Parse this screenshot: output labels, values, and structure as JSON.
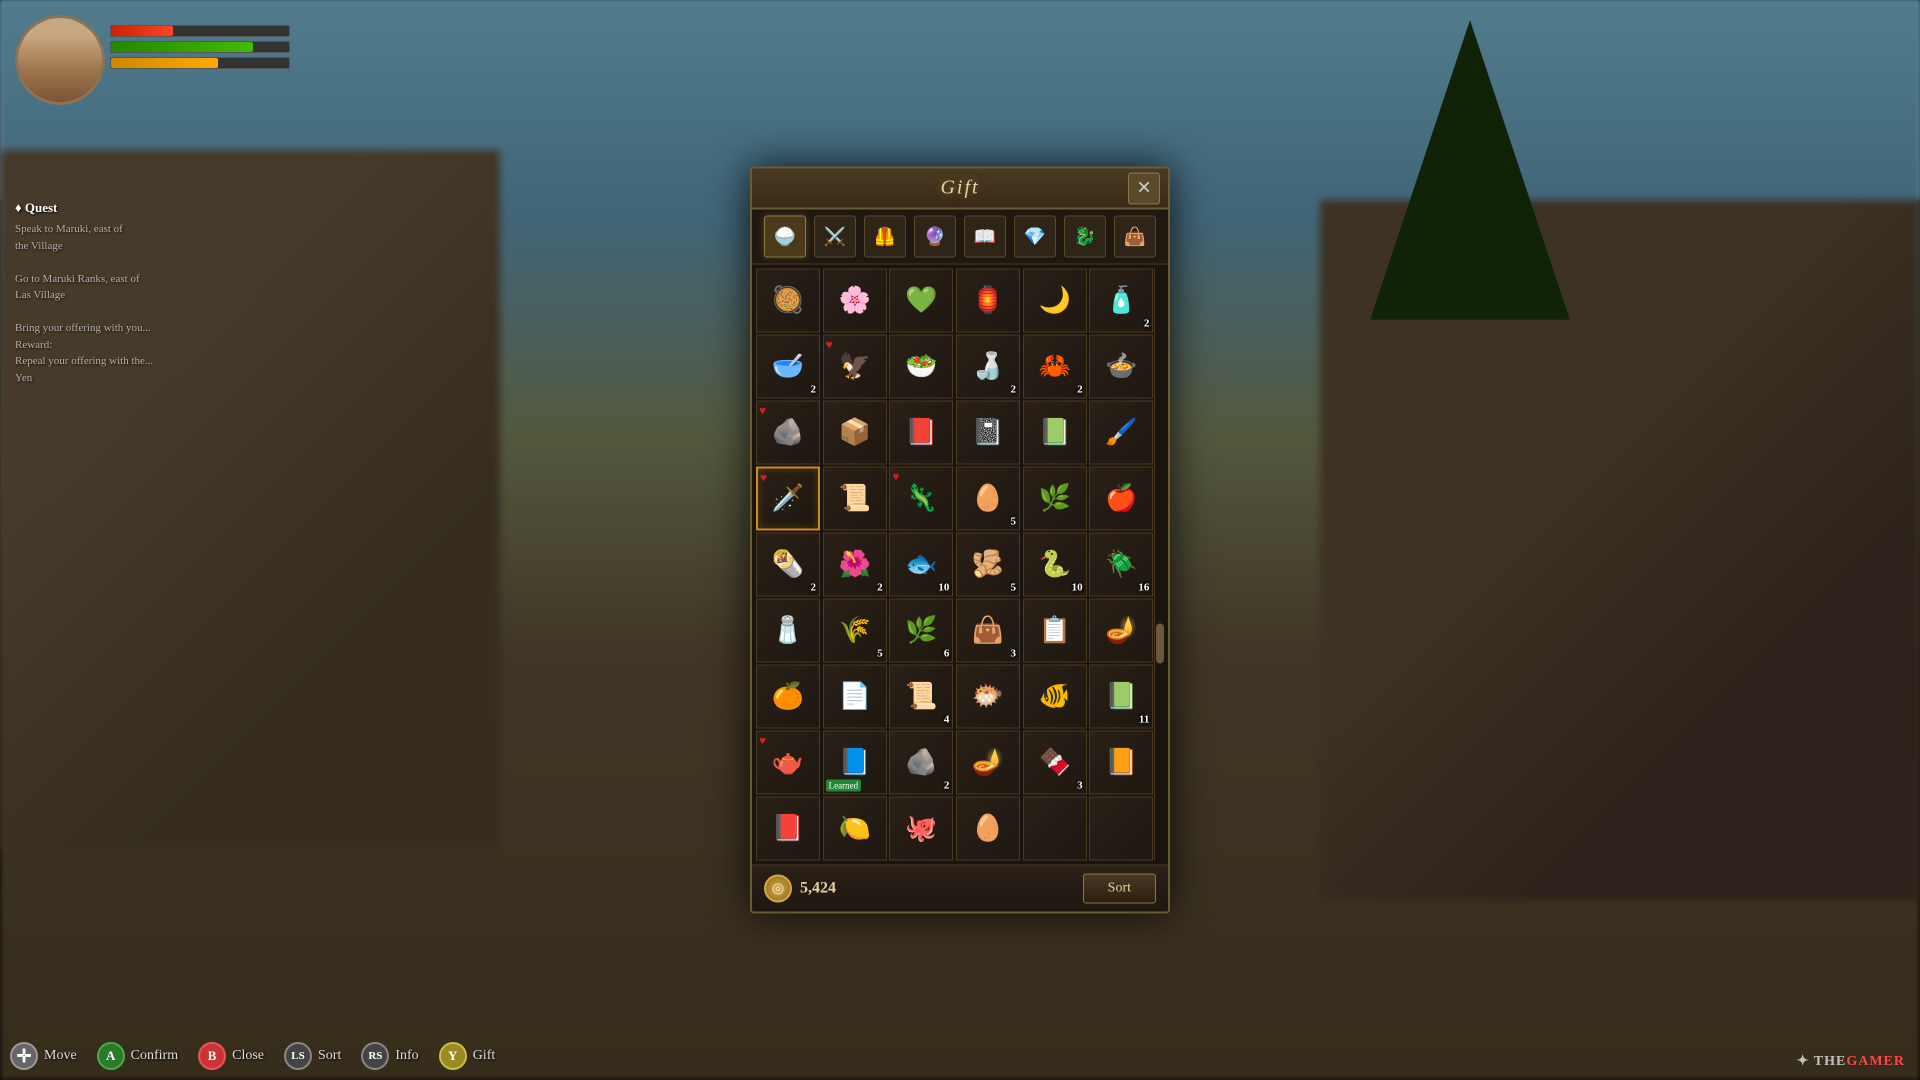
{
  "background": {
    "sky_color": "#87CEEB"
  },
  "dialog": {
    "title": "Gift",
    "close_label": "✕",
    "currency_value": "5,424",
    "sort_label": "Sort",
    "tabs": [
      {
        "id": "consumables",
        "icon": "🍚",
        "active": true
      },
      {
        "id": "weapons",
        "icon": "⚔️",
        "active": false
      },
      {
        "id": "armor",
        "icon": "🦺",
        "active": false
      },
      {
        "id": "accessories",
        "icon": "🔮",
        "active": false
      },
      {
        "id": "books",
        "icon": "📖",
        "active": false
      },
      {
        "id": "materials",
        "icon": "💎",
        "active": false
      },
      {
        "id": "special",
        "icon": "🐉",
        "active": false
      },
      {
        "id": "misc",
        "icon": "👜",
        "active": false
      }
    ],
    "items": [
      {
        "row": 0,
        "col": 0,
        "icon": "🥘",
        "qty": null,
        "favorited": false,
        "selected": false,
        "badge": null
      },
      {
        "row": 0,
        "col": 1,
        "icon": "🌸",
        "qty": null,
        "favorited": false,
        "selected": false,
        "badge": null
      },
      {
        "row": 0,
        "col": 2,
        "icon": "💚",
        "qty": null,
        "favorited": false,
        "selected": false,
        "badge": null
      },
      {
        "row": 0,
        "col": 3,
        "icon": "🏮",
        "qty": null,
        "favorited": false,
        "selected": false,
        "badge": null
      },
      {
        "row": 0,
        "col": 4,
        "icon": "🌙",
        "qty": null,
        "favorited": false,
        "selected": false,
        "badge": null
      },
      {
        "row": 0,
        "col": 5,
        "icon": "🧴",
        "qty": 2,
        "favorited": false,
        "selected": false,
        "badge": null
      },
      {
        "row": 1,
        "col": 0,
        "icon": "🥣",
        "qty": 2,
        "favorited": false,
        "selected": false,
        "badge": null
      },
      {
        "row": 1,
        "col": 1,
        "icon": "🦅",
        "qty": null,
        "favorited": true,
        "selected": false,
        "badge": null
      },
      {
        "row": 1,
        "col": 2,
        "icon": "🥗",
        "qty": null,
        "favorited": false,
        "selected": false,
        "badge": null
      },
      {
        "row": 1,
        "col": 3,
        "icon": "🍶",
        "qty": 2,
        "favorited": false,
        "selected": false,
        "badge": null
      },
      {
        "row": 1,
        "col": 4,
        "icon": "🦀",
        "qty": 2,
        "favorited": false,
        "selected": false,
        "badge": null
      },
      {
        "row": 1,
        "col": 5,
        "icon": "🍲",
        "qty": null,
        "favorited": false,
        "selected": false,
        "badge": null
      },
      {
        "row": 2,
        "col": 0,
        "icon": "🪨",
        "qty": null,
        "favorited": true,
        "selected": false,
        "badge": null
      },
      {
        "row": 2,
        "col": 1,
        "icon": "📦",
        "qty": null,
        "favorited": false,
        "selected": false,
        "badge": null
      },
      {
        "row": 2,
        "col": 2,
        "icon": "📕",
        "qty": null,
        "favorited": false,
        "selected": false,
        "badge": null
      },
      {
        "row": 2,
        "col": 3,
        "icon": "📓",
        "qty": null,
        "favorited": false,
        "selected": false,
        "badge": null
      },
      {
        "row": 2,
        "col": 4,
        "icon": "📗",
        "qty": null,
        "favorited": false,
        "selected": false,
        "badge": null
      },
      {
        "row": 2,
        "col": 5,
        "icon": "🖌️",
        "qty": null,
        "favorited": false,
        "selected": false,
        "badge": null
      },
      {
        "row": 3,
        "col": 0,
        "icon": "🗡️",
        "qty": null,
        "favorited": true,
        "selected": true,
        "badge": null
      },
      {
        "row": 3,
        "col": 1,
        "icon": "📜",
        "qty": null,
        "favorited": false,
        "selected": false,
        "badge": null
      },
      {
        "row": 3,
        "col": 2,
        "icon": "🦎",
        "qty": null,
        "favorited": true,
        "selected": false,
        "badge": null
      },
      {
        "row": 3,
        "col": 3,
        "icon": "🥚",
        "qty": 5,
        "favorited": false,
        "selected": false,
        "badge": null
      },
      {
        "row": 3,
        "col": 4,
        "icon": "🌿",
        "qty": null,
        "favorited": false,
        "selected": false,
        "badge": null
      },
      {
        "row": 3,
        "col": 5,
        "icon": "🍎",
        "qty": null,
        "favorited": false,
        "selected": false,
        "badge": null
      },
      {
        "row": 4,
        "col": 0,
        "icon": "🌯",
        "qty": 2,
        "favorited": false,
        "selected": false,
        "badge": null
      },
      {
        "row": 4,
        "col": 1,
        "icon": "🌺",
        "qty": 2,
        "favorited": false,
        "selected": false,
        "badge": null
      },
      {
        "row": 4,
        "col": 2,
        "icon": "🐟",
        "qty": 10,
        "favorited": false,
        "selected": false,
        "badge": null
      },
      {
        "row": 4,
        "col": 3,
        "icon": "🫚",
        "qty": 5,
        "favorited": false,
        "selected": false,
        "badge": null
      },
      {
        "row": 4,
        "col": 4,
        "icon": "🐍",
        "qty": 10,
        "favorited": false,
        "selected": false,
        "badge": null
      },
      {
        "row": 4,
        "col": 5,
        "icon": "🪲",
        "qty": 16,
        "favorited": false,
        "selected": false,
        "badge": null
      },
      {
        "row": 5,
        "col": 0,
        "icon": "🧂",
        "qty": null,
        "favorited": false,
        "selected": false,
        "badge": null
      },
      {
        "row": 5,
        "col": 1,
        "icon": "🌾",
        "qty": 5,
        "favorited": false,
        "selected": false,
        "badge": null
      },
      {
        "row": 5,
        "col": 2,
        "icon": "🌿",
        "qty": 6,
        "favorited": false,
        "selected": false,
        "badge": null
      },
      {
        "row": 5,
        "col": 3,
        "icon": "👜",
        "qty": 3,
        "favorited": false,
        "selected": false,
        "badge": null
      },
      {
        "row": 5,
        "col": 4,
        "icon": "📋",
        "qty": null,
        "favorited": false,
        "selected": false,
        "badge": null
      },
      {
        "row": 5,
        "col": 5,
        "icon": "🪔",
        "qty": null,
        "favorited": false,
        "selected": false,
        "badge": null
      },
      {
        "row": 6,
        "col": 0,
        "icon": "🍊",
        "qty": null,
        "favorited": false,
        "selected": false,
        "badge": null
      },
      {
        "row": 6,
        "col": 1,
        "icon": "📄",
        "qty": null,
        "favorited": false,
        "selected": false,
        "badge": null
      },
      {
        "row": 6,
        "col": 2,
        "icon": "📜",
        "qty": 4,
        "favorited": false,
        "selected": false,
        "badge": null
      },
      {
        "row": 6,
        "col": 3,
        "icon": "🐡",
        "qty": null,
        "favorited": false,
        "selected": false,
        "badge": null
      },
      {
        "row": 6,
        "col": 4,
        "icon": "🐠",
        "qty": null,
        "favorited": false,
        "selected": false,
        "badge": null
      },
      {
        "row": 6,
        "col": 5,
        "icon": "📗",
        "qty": 11,
        "favorited": false,
        "selected": false,
        "badge": null
      },
      {
        "row": 7,
        "col": 0,
        "icon": "🫖",
        "qty": null,
        "favorited": true,
        "selected": false,
        "badge": null
      },
      {
        "row": 7,
        "col": 1,
        "icon": "📘",
        "qty": null,
        "favorited": false,
        "selected": false,
        "badge": "Learned"
      },
      {
        "row": 7,
        "col": 2,
        "icon": "🪨",
        "qty": 2,
        "favorited": false,
        "selected": false,
        "badge": null
      },
      {
        "row": 7,
        "col": 3,
        "icon": "🪔",
        "qty": null,
        "favorited": false,
        "selected": false,
        "badge": null
      },
      {
        "row": 7,
        "col": 4,
        "icon": "🍫",
        "qty": 3,
        "favorited": false,
        "selected": false,
        "badge": null
      },
      {
        "row": 7,
        "col": 5,
        "icon": "📙",
        "qty": null,
        "favorited": false,
        "selected": false,
        "badge": null
      },
      {
        "row": 8,
        "col": 0,
        "icon": "📕",
        "qty": null,
        "favorited": false,
        "selected": false,
        "badge": null
      },
      {
        "row": 8,
        "col": 1,
        "icon": "🍋",
        "qty": null,
        "favorited": false,
        "selected": false,
        "badge": null
      },
      {
        "row": 8,
        "col": 2,
        "icon": "🐙",
        "qty": null,
        "favorited": false,
        "selected": false,
        "badge": null
      },
      {
        "row": 8,
        "col": 3,
        "icon": "🥚",
        "qty": null,
        "favorited": false,
        "selected": false,
        "badge": null
      }
    ]
  },
  "hud": {
    "buttons": [
      {
        "icon": "✛",
        "icon_bg": "#888",
        "label": "Move",
        "type": "dpad"
      },
      {
        "icon": "A",
        "icon_bg": "#2a8a2a",
        "label": "Confirm",
        "type": "circle"
      },
      {
        "icon": "B",
        "icon_bg": "#cc3333",
        "label": "Close",
        "type": "circle"
      },
      {
        "icon": "LS",
        "icon_bg": "#555",
        "label": "Sort",
        "type": "stick"
      },
      {
        "icon": "RS",
        "icon_bg": "#555",
        "label": "Info",
        "type": "stick"
      },
      {
        "icon": "Y",
        "icon_bg": "#ccaa22",
        "label": "Gift",
        "type": "circle"
      }
    ]
  },
  "watermark": {
    "prefix": "THE",
    "highlight": "GAMER"
  }
}
